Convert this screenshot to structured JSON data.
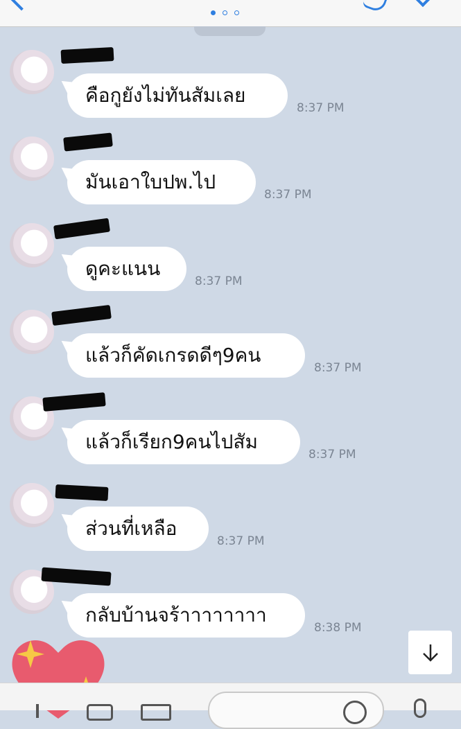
{
  "header": {
    "page_indicator_count": 3,
    "active_page": 0
  },
  "messages": [
    {
      "text": "คือกูยังไม่ทันสัมเลย",
      "time": "8:37 PM"
    },
    {
      "text": "มันเอาใบปพ.ไป",
      "time": "8:37 PM"
    },
    {
      "text": "ดูคะแนน",
      "time": "8:37 PM"
    },
    {
      "text": "แล้วก็คัดเกรดดีๆ9คน",
      "time": "8:37 PM"
    },
    {
      "text": "แล้วก็เรียก9คนไปสัม",
      "time": "8:37 PM"
    },
    {
      "text": "ส่วนที่เหลือ",
      "time": "8:37 PM"
    },
    {
      "text": "กลับบ้านจร้าาาาาาาา",
      "time": "8:38 PM"
    }
  ],
  "icons": {
    "back": "chevron-left-icon",
    "call": "phone-icon",
    "menu": "chevron-down-icon",
    "scroll_down": "arrow-down-icon",
    "sticker": "heart-sparkle-icon"
  },
  "colors": {
    "accent": "#2f7fe0",
    "chat_background": "#cfd9e6",
    "bubble": "#ffffff",
    "time_text": "#7b8593",
    "heart": "#e85b6e",
    "sparkle": "#f6c945"
  }
}
